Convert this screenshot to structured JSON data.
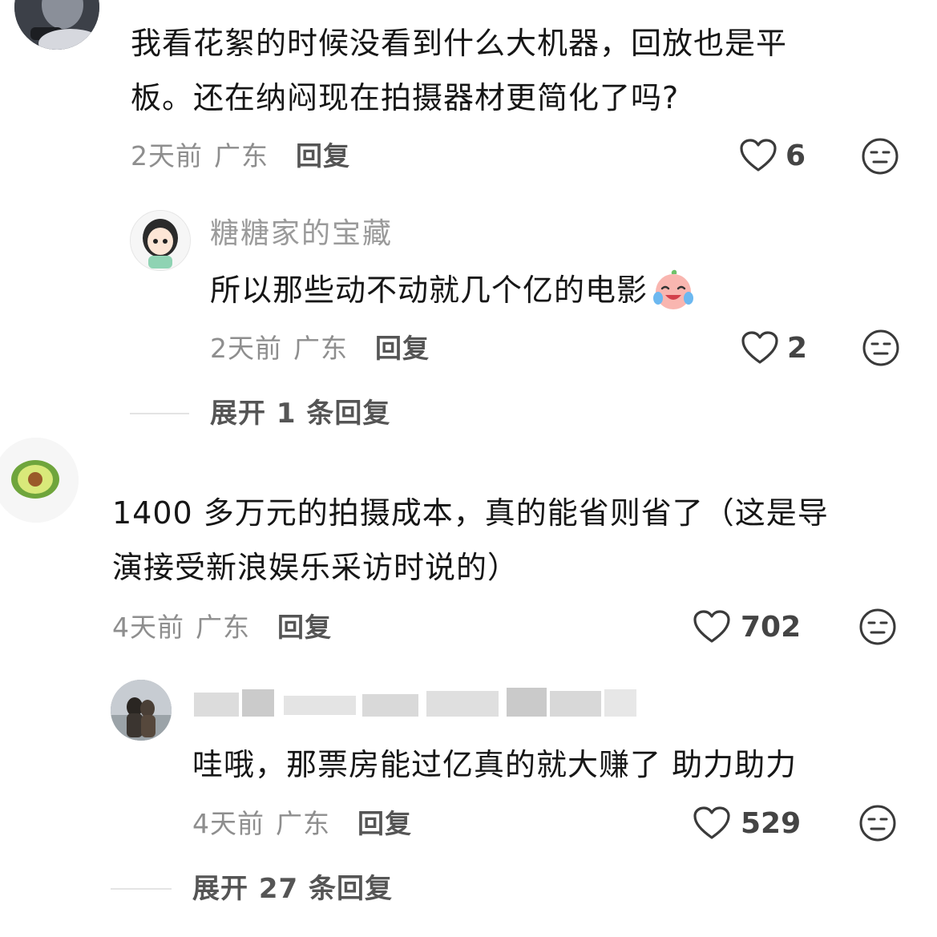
{
  "comments": [
    {
      "text_line1": "我看花絮的时候没看到什么大机器，回放也是平",
      "text_line2": "板。还在纳闷现在拍摄器材更简化了吗?",
      "time": "2天前",
      "location": "广东",
      "reply_label": "回复",
      "likes": "6",
      "replies": [
        {
          "username": "糖糖家的宝藏",
          "text": "所以那些动不动就几个亿的电影",
          "time": "2天前",
          "location": "广东",
          "reply_label": "回复",
          "likes": "2"
        }
      ],
      "expand_label": "展开 1 条回复"
    },
    {
      "text_line1": "1400 多万元的拍摄成本，真的能省则省了（这是导",
      "text_line2": "演接受新浪娱乐采访时说的）",
      "time": "4天前",
      "location": "广东",
      "reply_label": "回复",
      "likes": "702",
      "replies": [
        {
          "text": "哇哦，那票房能过亿真的就大赚了 助力助力",
          "time": "4天前",
          "location": "广东",
          "reply_label": "回复",
          "likes": "529"
        }
      ],
      "expand_label": "展开 27 条回复"
    }
  ],
  "icons": {
    "like": "heart-outline-icon",
    "dislike": "meh-face-icon",
    "emoji": "crying-laughing-emoji"
  },
  "colors": {
    "text": "#161616",
    "meta": "#8e8e8e",
    "divider": "#e4e4e4"
  }
}
